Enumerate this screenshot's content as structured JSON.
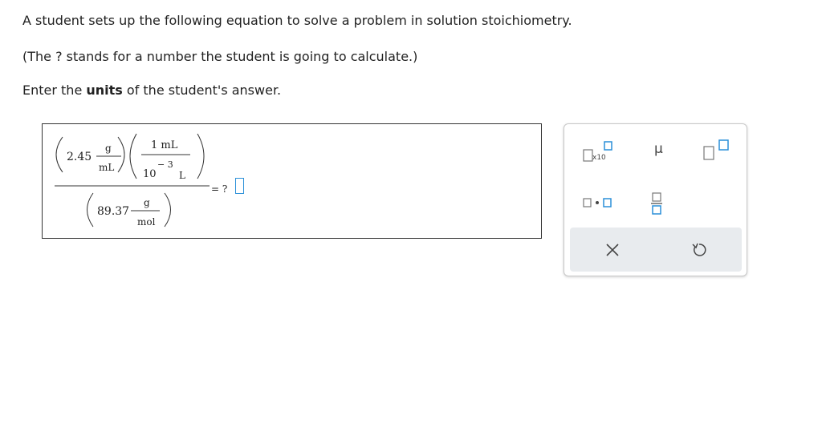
{
  "question": {
    "line1": "A student sets up the following equation to solve a problem in solution stoichiometry.",
    "line2": "(The ? stands for a number the student is going to calculate.)",
    "line3_prefix": "Enter the ",
    "line3_bold": "units",
    "line3_suffix": " of the student's answer."
  },
  "equation": {
    "term1_value": "2.45",
    "term1_num_unit": "g",
    "term1_den_unit": "mL",
    "term2_num": "1 mL",
    "term2_den_base": "10",
    "term2_den_exp": "− 3",
    "term2_den_unit": "L",
    "term3_value": "89.37",
    "term3_num_unit": "g",
    "term3_den_unit": "mol",
    "result": "= ?"
  },
  "palette": {
    "sci_label": "x10",
    "mu_label": "μ"
  },
  "colors": {
    "accent": "#2a8fd8",
    "box_gray": "#777777",
    "text": "#222222"
  },
  "icons": [
    "superscript-icon",
    "scientific-notation-icon",
    "mu-symbol-icon",
    "multiply-dot-icon",
    "fraction-icon",
    "clear-x-icon",
    "undo-icon"
  ]
}
